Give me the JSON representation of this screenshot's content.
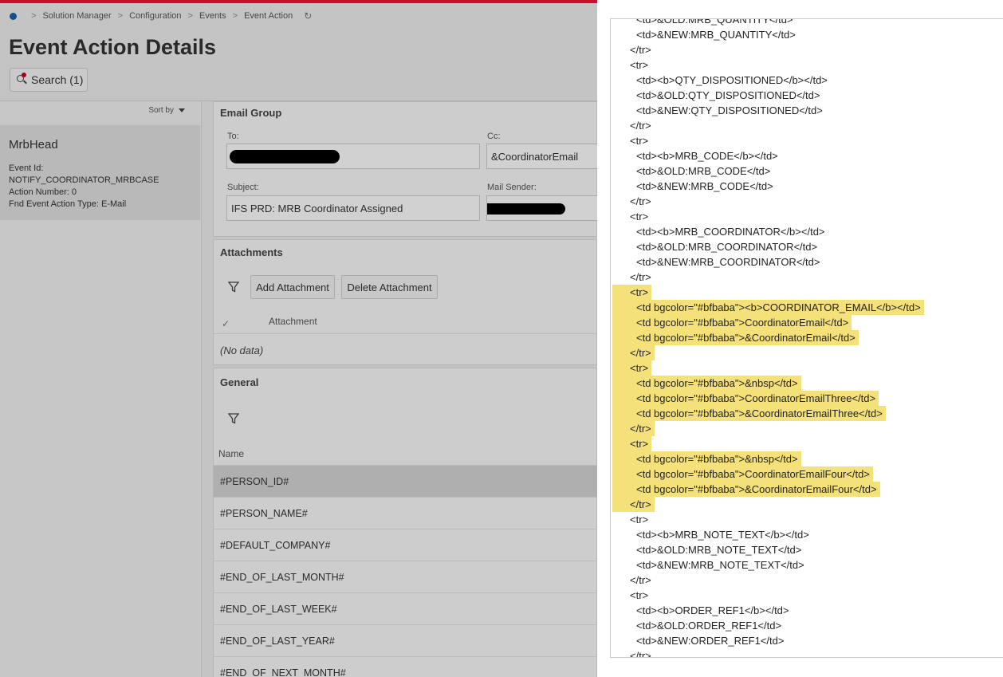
{
  "breadcrumb": [
    "Solution Manager",
    "Configuration",
    "Events",
    "Event Action"
  ],
  "page_title": "Event Action Details",
  "search_button": "Search (1)",
  "sort_by": "Sort by",
  "record": {
    "title": "MrbHead",
    "event_id_label": "Event Id:",
    "event_id_value": "NOTIFY_COORDINATOR_MRBCASE",
    "action_number": "Action Number:   0",
    "action_type": "Fnd Event Action Type:   E-Mail"
  },
  "email_group": {
    "title": "Email Group",
    "to_label": "To:",
    "cc_label": "Cc:",
    "cc_value": "&CoordinatorEmail",
    "subject_label": "Subject:",
    "subject_value": "IFS PRD: MRB Coordinator Assigned",
    "sender_label": "Mail Sender:"
  },
  "attachments": {
    "title": "Attachments",
    "add_button": "Add Attachment",
    "delete_button": "Delete Attachment",
    "column": "Attachment",
    "check_mark": "✓",
    "empty": "(No data)"
  },
  "general": {
    "title": "General",
    "column": "Name",
    "rows": [
      "#PERSON_ID#",
      "#PERSON_NAME#",
      "#DEFAULT_COMPANY#",
      "#END_OF_LAST_MONTH#",
      "#END_OF_LAST_WEEK#",
      "#END_OF_LAST_YEAR#",
      "#END_OF_NEXT_MONTH#"
    ]
  },
  "code": [
    {
      "text": "<td>&OLD:MRB_QUANTITY</td>",
      "indent": 2,
      "hl": false
    },
    {
      "text": "<td>&NEW:MRB_QUANTITY</td>",
      "indent": 2,
      "hl": false
    },
    {
      "text": "</tr>",
      "indent": 1,
      "hl": false
    },
    {
      "text": "<tr>",
      "indent": 1,
      "hl": false
    },
    {
      "text": "<td><b>QTY_DISPOSITIONED</b></td>",
      "indent": 2,
      "hl": false
    },
    {
      "text": "<td>&OLD:QTY_DISPOSITIONED</td>",
      "indent": 2,
      "hl": false
    },
    {
      "text": "<td>&NEW:QTY_DISPOSITIONED</td>",
      "indent": 2,
      "hl": false
    },
    {
      "text": "</tr>",
      "indent": 1,
      "hl": false
    },
    {
      "text": "<tr>",
      "indent": 1,
      "hl": false
    },
    {
      "text": "<td><b>MRB_CODE</b></td>",
      "indent": 2,
      "hl": false
    },
    {
      "text": "<td>&OLD:MRB_CODE</td>",
      "indent": 2,
      "hl": false
    },
    {
      "text": "<td>&NEW:MRB_CODE</td>",
      "indent": 2,
      "hl": false
    },
    {
      "text": "</tr>",
      "indent": 1,
      "hl": false
    },
    {
      "text": "<tr>",
      "indent": 1,
      "hl": false
    },
    {
      "text": "<td><b>MRB_COORDINATOR</b></td>",
      "indent": 2,
      "hl": false
    },
    {
      "text": "<td>&OLD:MRB_COORDINATOR</td>",
      "indent": 2,
      "hl": false
    },
    {
      "text": "<td>&NEW:MRB_COORDINATOR</td>",
      "indent": 2,
      "hl": false
    },
    {
      "text": "</tr>",
      "indent": 1,
      "hl": false
    },
    {
      "text": "<tr>",
      "indent": 1,
      "hl": true
    },
    {
      "text": "<td bgcolor=\"#bfbaba\"><b>COORDINATOR_EMAIL</b></td>",
      "indent": 2,
      "hl": true
    },
    {
      "text": "<td bgcolor=\"#bfbaba\">CoordinatorEmail</td>",
      "indent": 2,
      "hl": true
    },
    {
      "text": "<td bgcolor=\"#bfbaba\">&CoordinatorEmail</td>",
      "indent": 2,
      "hl": true
    },
    {
      "text": "</tr>",
      "indent": 1,
      "hl": true
    },
    {
      "text": "<tr>",
      "indent": 1,
      "hl": true
    },
    {
      "text": "<td bgcolor=\"#bfbaba\">&nbsp</td>",
      "indent": 2,
      "hl": true
    },
    {
      "text": "<td bgcolor=\"#bfbaba\">CoordinatorEmailThree</td>",
      "indent": 2,
      "hl": true
    },
    {
      "text": "<td bgcolor=\"#bfbaba\">&CoordinatorEmailThree</td>",
      "indent": 2,
      "hl": true
    },
    {
      "text": "</tr>",
      "indent": 1,
      "hl": true
    },
    {
      "text": "<tr>",
      "indent": 1,
      "hl": true
    },
    {
      "text": "<td bgcolor=\"#bfbaba\">&nbsp</td>",
      "indent": 2,
      "hl": true
    },
    {
      "text": "<td bgcolor=\"#bfbaba\">CoordinatorEmailFour</td>",
      "indent": 2,
      "hl": true
    },
    {
      "text": "<td bgcolor=\"#bfbaba\">&CoordinatorEmailFour</td>",
      "indent": 2,
      "hl": true
    },
    {
      "text": "</tr>",
      "indent": 1,
      "hl": true
    },
    {
      "text": "<tr>",
      "indent": 1,
      "hl": false
    },
    {
      "text": "<td><b>MRB_NOTE_TEXT</b></td>",
      "indent": 2,
      "hl": false
    },
    {
      "text": "<td>&OLD:MRB_NOTE_TEXT</td>",
      "indent": 2,
      "hl": false
    },
    {
      "text": "<td>&NEW:MRB_NOTE_TEXT</td>",
      "indent": 2,
      "hl": false
    },
    {
      "text": "</tr>",
      "indent": 1,
      "hl": false
    },
    {
      "text": "<tr>",
      "indent": 1,
      "hl": false
    },
    {
      "text": "<td><b>ORDER_REF1</b></td>",
      "indent": 2,
      "hl": false
    },
    {
      "text": "<td>&OLD:ORDER_REF1</td>",
      "indent": 2,
      "hl": false
    },
    {
      "text": "<td>&NEW:ORDER_REF1</td>",
      "indent": 2,
      "hl": false
    },
    {
      "text": "</tr>",
      "indent": 1,
      "hl": false
    }
  ],
  "colors": {
    "brand_bar": "#c8102e",
    "highlight": "#f5e17a",
    "home_dot": "#1f5fa8"
  }
}
